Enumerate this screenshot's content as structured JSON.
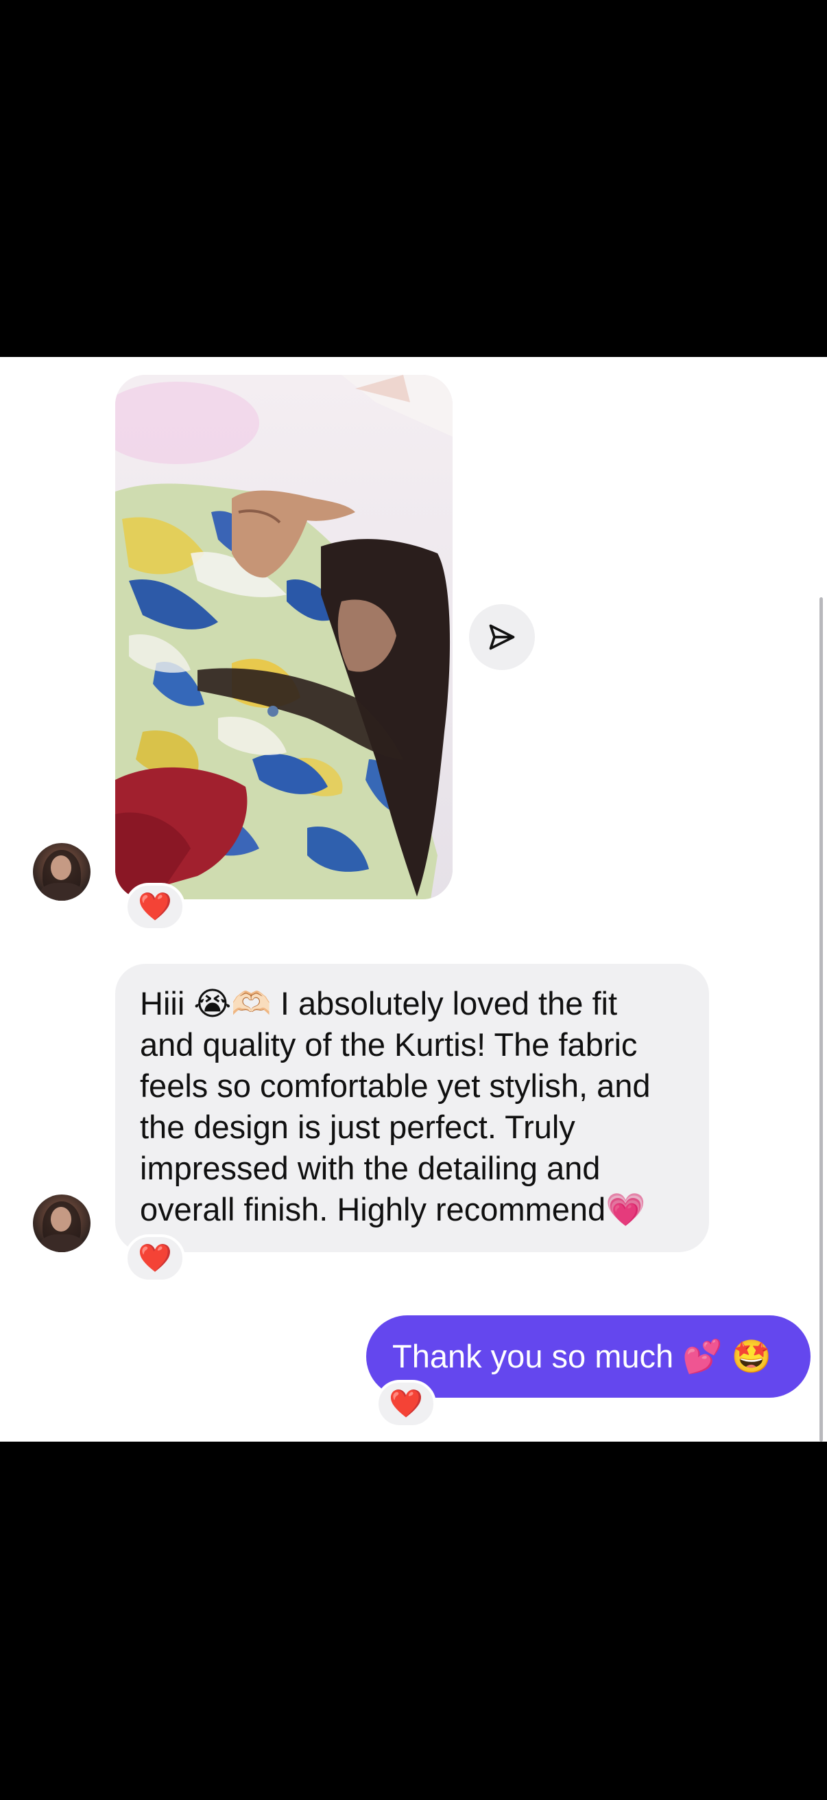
{
  "conversation": {
    "photo_message": {
      "reaction": "❤️"
    },
    "text_message": {
      "lines": [
        "Hiii 😭🫶🏻 I absolutely loved the fit",
        "and quality of the  Kurtis! The fabric",
        "feels so comfortable yet stylish, and",
        "the design is just perfect. Truly",
        "impressed with the detailing and",
        "overall finish. Highly recommend💗"
      ],
      "reaction": "❤️"
    },
    "reply_message": {
      "text": "Thank you so much 💕 🤩",
      "reaction": "❤️"
    }
  },
  "colors": {
    "outgoing_bubble": "#6447ee",
    "incoming_bubble": "#f0f0f2"
  },
  "icons": {
    "share": "paper-plane-icon",
    "reaction": "heart-icon"
  }
}
